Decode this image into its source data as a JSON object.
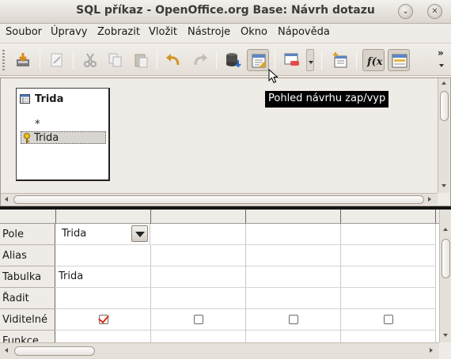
{
  "window": {
    "title": "SQL příkaz - OpenOffice.org Base: Návrh dotazu",
    "minimize_icon": "chevron-down-icon",
    "close_icon": "close-icon"
  },
  "menu": {
    "items": [
      {
        "label": "Soubor"
      },
      {
        "label": "Úpravy"
      },
      {
        "label": "Zobrazit"
      },
      {
        "label": "Vložit"
      },
      {
        "label": "Nástroje"
      },
      {
        "label": "Okno"
      },
      {
        "label": "Nápověda"
      }
    ]
  },
  "toolbar": {
    "buttons": [
      {
        "icon": "save-icon"
      },
      {
        "icon": "edit-icon"
      },
      {
        "icon": "cut-icon"
      },
      {
        "icon": "copy-icon"
      },
      {
        "icon": "paste-icon"
      },
      {
        "icon": "undo-icon"
      },
      {
        "icon": "redo-icon"
      },
      {
        "icon": "run-query-icon"
      },
      {
        "icon": "design-view-toggle-icon",
        "active": true
      },
      {
        "icon": "clear-query-icon"
      },
      {
        "icon": "add-table-icon"
      },
      {
        "icon": "functions-icon",
        "active": true
      },
      {
        "icon": "table-name-icon",
        "active": true
      }
    ],
    "tooltip": "Pohled návrhu zap/vyp"
  },
  "table_window": {
    "title": "Trida",
    "fields": [
      "*",
      "Trida"
    ]
  },
  "grid": {
    "row_labels": [
      "Pole",
      "Alias",
      "Tabulka",
      "Řadit",
      "Viditelné",
      "Funkce"
    ],
    "columns": [
      {
        "field": "Trida",
        "alias": "",
        "table": "Trida",
        "sort": "",
        "visible": true
      },
      {
        "field": "",
        "alias": "",
        "table": "",
        "sort": "",
        "visible": false
      },
      {
        "field": "",
        "alias": "",
        "table": "",
        "sort": "",
        "visible": false
      },
      {
        "field": "",
        "alias": "",
        "table": "",
        "sort": "",
        "visible": false
      }
    ]
  }
}
